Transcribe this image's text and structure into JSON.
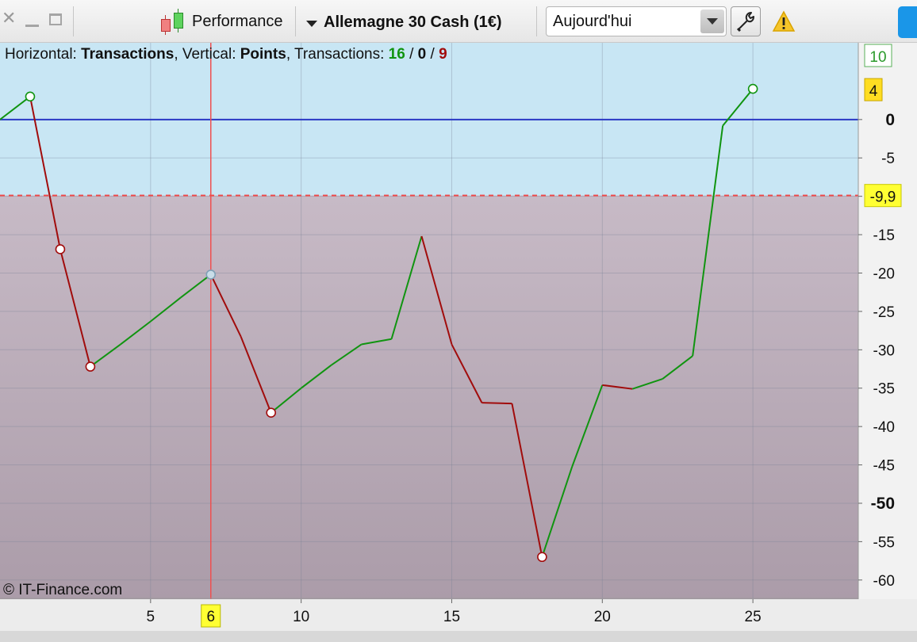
{
  "toolbar": {
    "performance_label": "Performance",
    "instrument_label": "Allemagne 30 Cash (1€)",
    "period_value": "Aujourd'hui",
    "icons": [
      "close-icon",
      "minimize-icon",
      "maximize-icon",
      "candlestick-icon",
      "dropdown-arrow-icon",
      "wrench-icon",
      "warning-icon"
    ]
  },
  "legend": {
    "horizontal_label": "Horizontal: ",
    "horizontal_value": "Transactions",
    "vertical_label": ", Vertical: ",
    "vertical_value": "Points",
    "transactions_label": ", Transactions: ",
    "count_winning": "16",
    "sep1": " / ",
    "count_neutral": "0",
    "sep2": " / ",
    "count_losing": "9"
  },
  "copyright": "© IT-Finance.com",
  "chart_data": {
    "type": "line",
    "xlabel": "Transactions",
    "ylabel": "Points",
    "x_ticks": [
      5,
      10,
      15,
      20,
      25
    ],
    "y_ticks": [
      0,
      -5,
      -10,
      -15,
      -20,
      -25,
      -30,
      -35,
      -40,
      -45,
      -50,
      -55,
      -60
    ],
    "y_tick_labels": [
      "0",
      "-5",
      "-9,9",
      "-15",
      "-20",
      "-25",
      "-30",
      "-35",
      "-40",
      "-45",
      "-50",
      "-55",
      "-60"
    ],
    "y_bold_ticks": [
      0,
      -50
    ],
    "xlim": [
      0,
      28.5
    ],
    "ylim": [
      -62.5,
      10
    ],
    "grid": true,
    "x": [
      0,
      1,
      2,
      3,
      4,
      5,
      6,
      7,
      8,
      9,
      10,
      11,
      12,
      13,
      14,
      15,
      16,
      17,
      18,
      19,
      20,
      21,
      22,
      23,
      24,
      25
    ],
    "y": [
      0,
      3.0,
      -16.9,
      -32.2,
      -29.3,
      -26.3,
      -23.2,
      -20.2,
      -28.3,
      -38.2,
      -35.0,
      -32.0,
      -29.3,
      -28.6,
      -15.2,
      -29.3,
      -36.9,
      -37.0,
      -57.0,
      -45.2,
      -34.6,
      -35.1,
      -33.8,
      -30.8,
      -0.8,
      4.0
    ],
    "colors": {
      "up": "#109410",
      "down": "#a10c0c",
      "zero_line": "#2a38c4",
      "marker": "#ee3b3b"
    },
    "markers": [
      {
        "x": 1,
        "y": 3.0,
        "type": "high"
      },
      {
        "x": 2,
        "y": -16.9,
        "type": "low"
      },
      {
        "x": 3,
        "y": -32.2,
        "type": "low"
      },
      {
        "x": 7,
        "y": -20.2,
        "type": "cursor"
      },
      {
        "x": 9,
        "y": -38.2,
        "type": "low"
      },
      {
        "x": 18,
        "y": -57.0,
        "type": "low"
      },
      {
        "x": 25,
        "y": 4.0,
        "type": "high"
      }
    ],
    "threshold": {
      "y": -9.9,
      "label": "-9,9"
    },
    "cursor": {
      "x": 7,
      "label": "6"
    },
    "last_value": {
      "y": 4.0,
      "label": "4"
    },
    "top_value_label": "10"
  }
}
